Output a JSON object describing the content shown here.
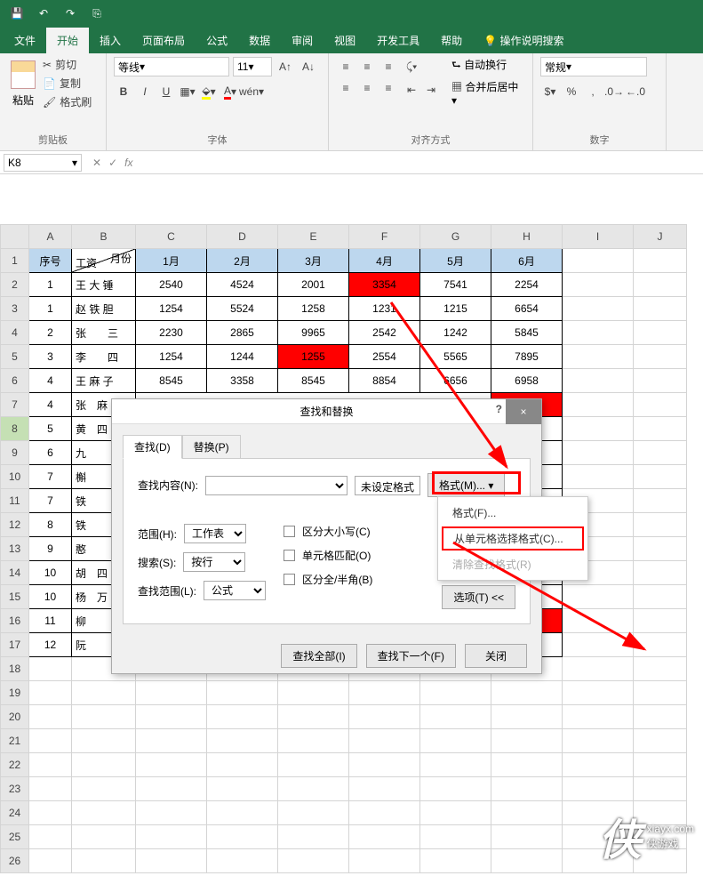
{
  "titlebar": {
    "save": "💾",
    "undo": "↶",
    "redo": "↷",
    "touch": "⎘"
  },
  "tabs": {
    "file": "文件",
    "home": "开始",
    "insert": "插入",
    "layout": "页面布局",
    "formula": "公式",
    "data": "数据",
    "review": "审阅",
    "view": "视图",
    "dev": "开发工具",
    "help": "帮助",
    "tellme": "操作说明搜索"
  },
  "ribbon": {
    "clipboard": {
      "label": "剪贴板",
      "paste": "粘贴",
      "cut": "剪切",
      "copy": "复制",
      "painter": "格式刷"
    },
    "font": {
      "label": "字体",
      "name": "等线",
      "size": "11",
      "bold": "B",
      "italic": "I",
      "underline": "U"
    },
    "align": {
      "label": "对齐方式",
      "wrap": "自动换行",
      "merge": "合并后居中"
    },
    "number": {
      "label": "数字",
      "format": "常规"
    }
  },
  "namebox": "K8",
  "cols": [
    "A",
    "B",
    "C",
    "D",
    "E",
    "F",
    "G",
    "H",
    "I",
    "J"
  ],
  "rows": [
    "1",
    "2",
    "3",
    "4",
    "5",
    "6",
    "7",
    "8",
    "9",
    "10",
    "11",
    "12",
    "13",
    "14",
    "15",
    "16",
    "17",
    "18",
    "19",
    "20",
    "21",
    "22",
    "23",
    "24",
    "25",
    "26"
  ],
  "headers": {
    "seq": "序号",
    "split_top": "月份",
    "split_bot": "工资",
    "m1": "1月",
    "m2": "2月",
    "m3": "3月",
    "m4": "4月",
    "m5": "5月",
    "m6": "6月"
  },
  "data": [
    {
      "seq": "1",
      "name": "王 大 锤",
      "v": [
        "2540",
        "4524",
        "2001",
        "3354",
        "7541",
        "2254"
      ],
      "red": 3
    },
    {
      "seq": "1",
      "name": "赵 铁 胆",
      "v": [
        "1254",
        "5524",
        "1258",
        "1231",
        "1215",
        "6654"
      ]
    },
    {
      "seq": "2",
      "name": "张　　三",
      "v": [
        "2230",
        "2865",
        "9965",
        "2542",
        "1242",
        "5845"
      ]
    },
    {
      "seq": "3",
      "name": "李　　四",
      "v": [
        "1254",
        "1244",
        "1255",
        "2554",
        "5565",
        "7895"
      ],
      "red": 2
    },
    {
      "seq": "4",
      "name": "王 麻 子",
      "v": [
        "8545",
        "3358",
        "8545",
        "8854",
        "6656",
        "6958"
      ]
    },
    {
      "seq": "4",
      "name": "张　麻"
    },
    {
      "seq": "5",
      "name": "黄　四"
    },
    {
      "seq": "6",
      "name": "九"
    },
    {
      "seq": "7",
      "name": "槲"
    },
    {
      "seq": "7",
      "name": "铁"
    },
    {
      "seq": "8",
      "name": "铁"
    },
    {
      "seq": "9",
      "name": "憨"
    },
    {
      "seq": "10",
      "name": "胡　四"
    },
    {
      "seq": "10",
      "name": "杨　万"
    },
    {
      "seq": "11",
      "name": "柳"
    },
    {
      "seq": "12",
      "name": "阮"
    }
  ],
  "dialog": {
    "title": "查找和替换",
    "help": "?",
    "close": "×",
    "tab_find": "查找(D)",
    "tab_replace": "替换(P)",
    "find_label": "查找内容(N):",
    "no_format": "未设定格式",
    "format_btn": "格式(M)...",
    "scope_label": "范围(H):",
    "scope_val": "工作表",
    "search_label": "搜索(S):",
    "search_val": "按行",
    "lookin_label": "查找范围(L):",
    "lookin_val": "公式",
    "case": "区分大小写(C)",
    "whole": "单元格匹配(O)",
    "width": "区分全/半角(B)",
    "options": "选项(T) <<",
    "findall": "查找全部(I)",
    "findnext": "查找下一个(F)",
    "closebtn": "关闭"
  },
  "format_menu": {
    "m1": "格式(F)...",
    "m2": "从单元格选择格式(C)...",
    "m3": "清除查找格式(R)"
  },
  "watermark": {
    "logo": "侠",
    "url": "xiayx.com",
    "name": "侠游戏"
  }
}
